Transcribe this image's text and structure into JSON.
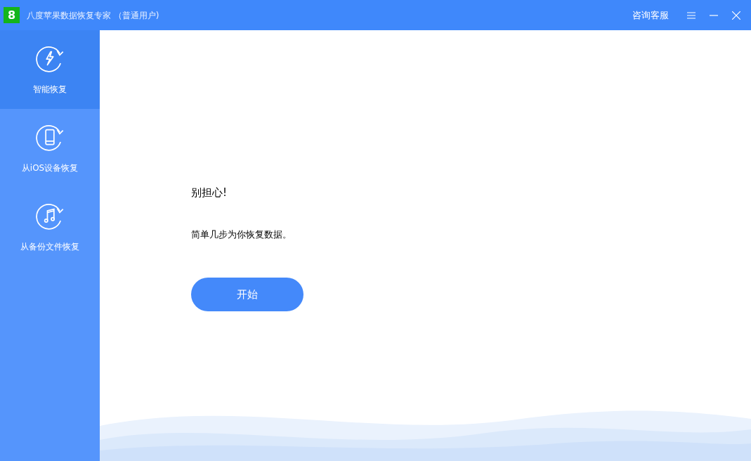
{
  "window": {
    "logo": "8",
    "title": "八度苹果数据恢复专家 （普通用户)",
    "support": "咨询客服"
  },
  "sidebar": {
    "items": [
      {
        "label": "智能恢复",
        "kind": "smart",
        "selected": true
      },
      {
        "label": "从iOS设备恢复",
        "kind": "device",
        "selected": false
      },
      {
        "label": "从备份文件恢复",
        "kind": "backup",
        "selected": false
      }
    ]
  },
  "main": {
    "heading": "别担心!",
    "text": "简单几步为你恢复数据。",
    "button": "开始"
  }
}
